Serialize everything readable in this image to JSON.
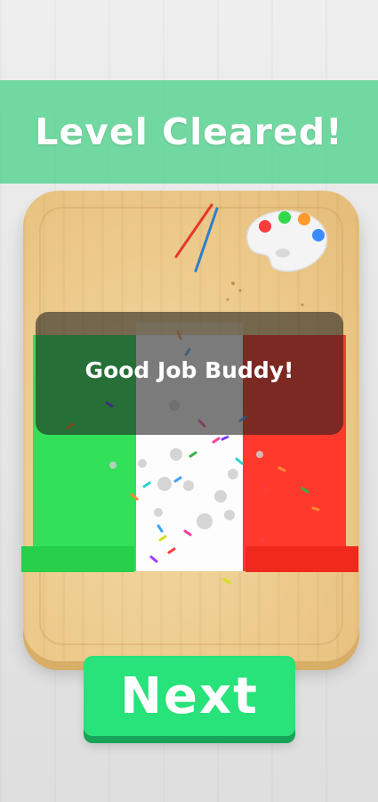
{
  "banner": {
    "title": "Level Cleared!"
  },
  "message": {
    "text": "Good Job Buddy!"
  },
  "next_button": {
    "label": "Next"
  },
  "colors": {
    "banner": "#50d28c",
    "flag_green": "#33e05a",
    "flag_white": "#fdfdfd",
    "flag_red": "#ff3a2c",
    "button": "#28e27a",
    "board": "#ecc98a"
  },
  "palette_paints": [
    "#ff3b3b",
    "#33d84a",
    "#ff9a2e",
    "#3b8cff"
  ],
  "icons": [
    "paint-palette-icon",
    "paintbrush-icon"
  ]
}
